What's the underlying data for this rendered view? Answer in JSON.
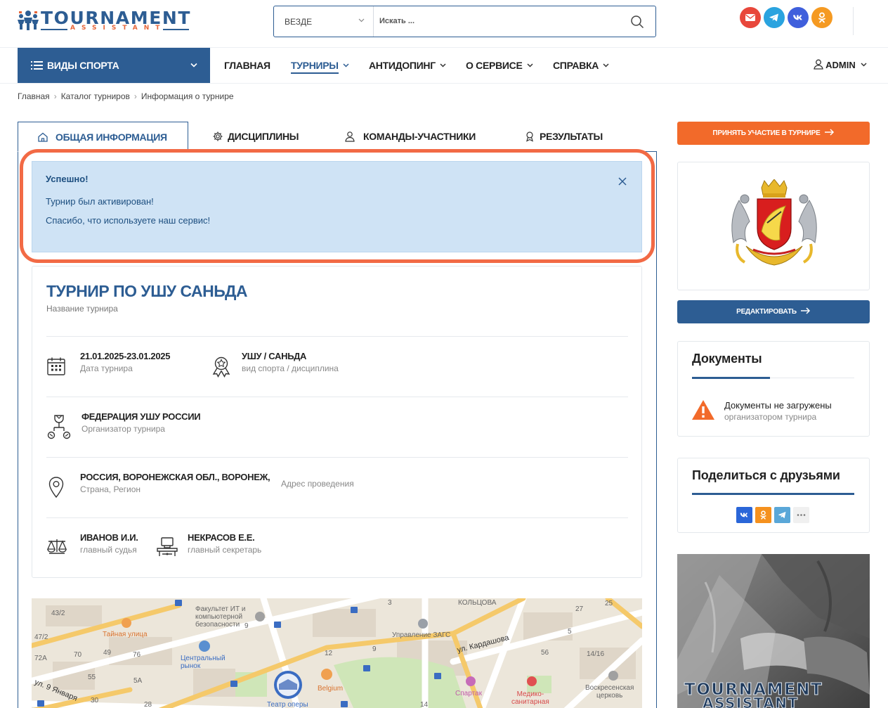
{
  "logo": {
    "main": "TOURNAMENT",
    "sub": "ASSISTANT"
  },
  "search": {
    "scope": "ВЕЗДЕ",
    "placeholder": "Искать ...",
    "value": ""
  },
  "social_colors": {
    "mail": "#e8473b",
    "telegram": "#2aa3df",
    "vk": "#3f5fdc",
    "ok": "#f59a22"
  },
  "nav": {
    "sports": "ВИДЫ СПОРТА",
    "items": [
      {
        "label": "ГЛАВНАЯ"
      },
      {
        "label": "ТУРНИРЫ"
      },
      {
        "label": "АНТИДОПИНГ"
      },
      {
        "label": "О СЕРВИСЕ"
      },
      {
        "label": "СПРАВКА"
      }
    ],
    "user": "ADMIN"
  },
  "breadcrumb": [
    "Главная",
    "Каталог турниров",
    "Информация о турнире"
  ],
  "tabs": [
    {
      "label": "ОБЩАЯ ИНФОРМАЦИЯ",
      "icon": "home-icon"
    },
    {
      "label": "ДИСЦИПЛИНЫ",
      "icon": "gear-icon"
    },
    {
      "label": "КОМАНДЫ-УЧАСТНИКИ",
      "icon": "user-icon"
    },
    {
      "label": "РЕЗУЛЬТАТЫ",
      "icon": "award-icon"
    }
  ],
  "alert": {
    "title": "Успешно!",
    "line1": "Турнир был активирован!",
    "line2": "Спасибо, что используете наш сервис!"
  },
  "tournament": {
    "name": "ТУРНИР ПО УШУ САНЬДА",
    "name_label": "Название турнира",
    "dates": "21.01.2025-23.01.2025",
    "dates_label": "Дата турнира",
    "sport": "УШУ / САНЬДА",
    "sport_label": "вид спорта / дисциплина",
    "organizer": "ФЕДЕРАЦИЯ УШУ РОССИИ",
    "organizer_label": "Организатор турнира",
    "location": "РОССИЯ, ВОРОНЕЖСКАЯ ОБЛ., ВОРОНЕЖ,",
    "location_label": "Страна, Регион",
    "address_label": "Адрес проведения",
    "judge": "ИВАНОВ И.И.",
    "judge_label": "главный судья",
    "secretary": "НЕКРАСОВ Е.Е.",
    "secretary_label": "главный секретарь"
  },
  "map": {
    "labels": {
      "it_faculty": "Факультет ИТ и\nкомпьютерной\nбезопасности",
      "secret_street": "Тайная улица",
      "central_market": "Центральный\nрынок",
      "zags": "Управление ЗАГС",
      "kardashova": "ул. Кардашова",
      "koltsova": "КОЛЬЦОВА",
      "belgium": "Belgium",
      "spartak": "Спартак",
      "medical": "Медико-\nсанитарная",
      "church": "Воскресенская\nцерковь",
      "opera": "Театр оперы",
      "jan9": "ул. 9 Января",
      "n43_2": "43/2",
      "n47_2": "47/2",
      "n70": "70",
      "n49": "49",
      "n76": "76",
      "n72a": "72А",
      "n55": "55",
      "n5a": "5А",
      "n30": "30",
      "n28": "28",
      "n9a": "9",
      "n12": "12",
      "n3": "3",
      "n27": "27",
      "n25": "25",
      "n56": "56",
      "n14_16": "14/16",
      "n5": "5",
      "n14": "14",
      "n9b": "9"
    }
  },
  "right": {
    "join_button": "ПРИНЯТЬ УЧАСТИЕ В ТУРНИРЕ",
    "edit_button": "РЕДАКТИРОВАТЬ",
    "docs_title": "Документы",
    "docs_empty": "Документы не загружены",
    "docs_empty_sub": "организатором турнира",
    "share_title": "Поделиться с друзьями",
    "banner_line1": "TOURNAMENT",
    "banner_line2": "ASSISTANT"
  }
}
